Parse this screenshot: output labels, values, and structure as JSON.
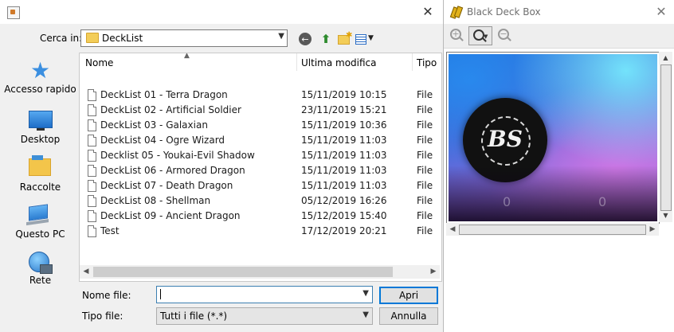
{
  "file_dialog": {
    "close_glyph": "✕",
    "look_in_label": "Cerca in:",
    "look_in_value": "DeckList",
    "columns": {
      "name": "Nome",
      "modified": "Ultima modifica",
      "type": "Tipo"
    },
    "places": [
      "Accesso rapido",
      "Desktop",
      "Raccolte",
      "Questo PC",
      "Rete"
    ],
    "files": [
      {
        "name": "DeckList 01 - Terra Dragon",
        "modified": "15/11/2019 10:15",
        "type": "File"
      },
      {
        "name": "DeckList 02 - Artificial Soldier",
        "modified": "23/11/2019 15:21",
        "type": "File"
      },
      {
        "name": "DeckList 03 - Galaxian",
        "modified": "15/11/2019 10:36",
        "type": "File"
      },
      {
        "name": "DeckList 04 - Ogre Wizard",
        "modified": "15/11/2019 11:03",
        "type": "File"
      },
      {
        "name": "Decklist 05 - Youkai-Evil Shadow",
        "modified": "15/11/2019 11:03",
        "type": "File"
      },
      {
        "name": "DeckList 06 - Armored Dragon",
        "modified": "15/11/2019 11:03",
        "type": "File"
      },
      {
        "name": "DeckList 07 - Death Dragon",
        "modified": "15/11/2019 11:03",
        "type": "File"
      },
      {
        "name": "DeckList 08 - Shellman",
        "modified": "05/12/2019 16:26",
        "type": "File"
      },
      {
        "name": "DeckList 09 -  Ancient Dragon",
        "modified": "15/12/2019 15:40",
        "type": "File"
      },
      {
        "name": "Test",
        "modified": "17/12/2019 20:21",
        "type": "File"
      }
    ],
    "file_name_label": "Nome file:",
    "file_name_value": "",
    "file_type_label": "Tipo file:",
    "file_type_value": "Tutti i file (*.*)",
    "open_button": "Apri",
    "cancel_button": "Annulla"
  },
  "deck_window": {
    "title": "Black Deck Box",
    "close_glyph": "✕",
    "emblem_text": "BS",
    "counter_left": "0",
    "counter_right": "0",
    "image_colors": {
      "top_left": "#1d6ed8",
      "bottom_right": "#b77fe0",
      "highlight": "#78f0ff"
    }
  }
}
